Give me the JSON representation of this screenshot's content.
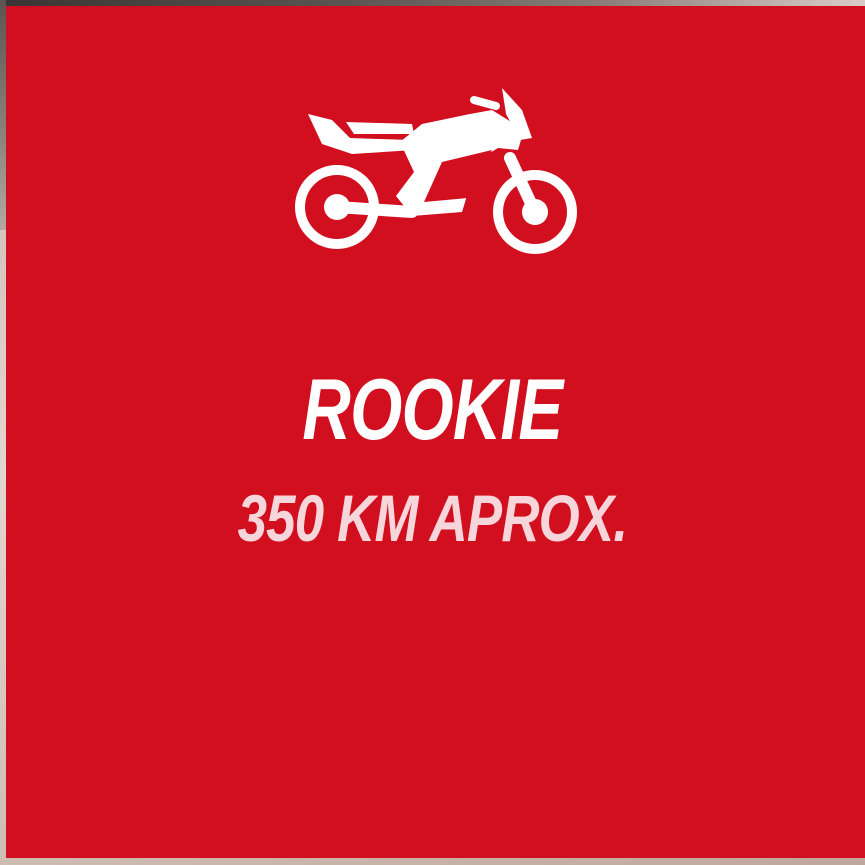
{
  "card": {
    "level": "ROOKIE",
    "distance": "350 KM APROX."
  },
  "icons": {
    "main": "motorcycle-icon"
  },
  "colors": {
    "card_background": "#d20f1f",
    "level_text": "#ffffff",
    "distance_text": "#f6d6da"
  }
}
